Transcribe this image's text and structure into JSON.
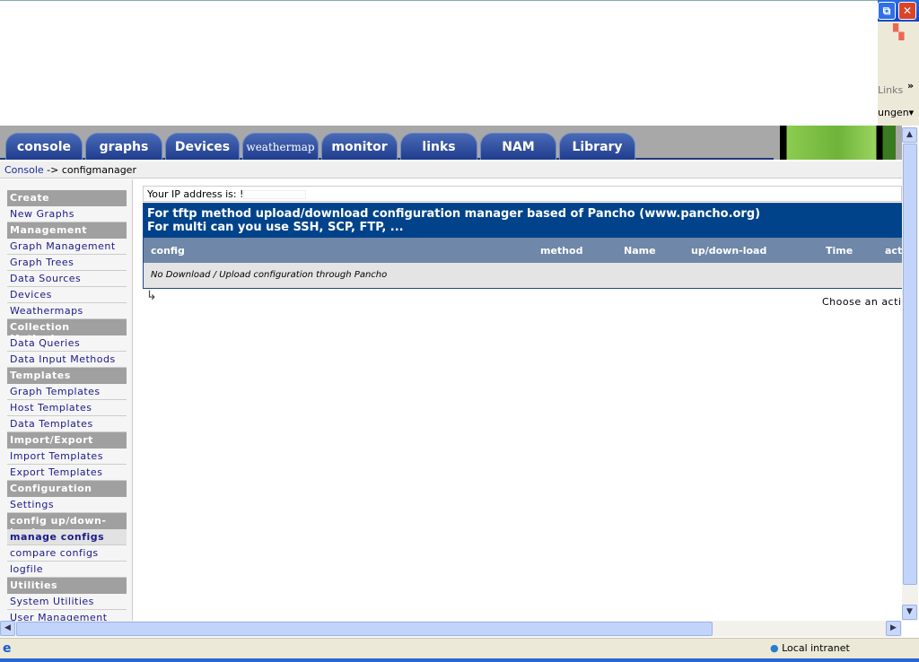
{
  "browser": {
    "links_label": "Links",
    "links_chevron": "»",
    "toolbar_partial": "ungen▾",
    "restore_icon": "⧉",
    "close_icon": "✕",
    "status_zone": "Local intranet"
  },
  "tabs": [
    {
      "label": "console"
    },
    {
      "label": "graphs"
    },
    {
      "label": "Devices"
    },
    {
      "label": "weathermap"
    },
    {
      "label": "monitor"
    },
    {
      "label": "links"
    },
    {
      "label": "NAM"
    },
    {
      "label": "Library"
    }
  ],
  "breadcrumb": {
    "root": "Console",
    "separator": " -> ",
    "current": "configmanager"
  },
  "sidebar": [
    {
      "type": "header",
      "label": "Create"
    },
    {
      "type": "item",
      "label": "New Graphs"
    },
    {
      "type": "header",
      "label": "Management"
    },
    {
      "type": "item",
      "label": "Graph Management"
    },
    {
      "type": "item",
      "label": "Graph Trees"
    },
    {
      "type": "item",
      "label": "Data Sources"
    },
    {
      "type": "item",
      "label": "Devices"
    },
    {
      "type": "item",
      "label": "Weathermaps"
    },
    {
      "type": "header",
      "label": "Collection Methods"
    },
    {
      "type": "item",
      "label": "Data Queries"
    },
    {
      "type": "item",
      "label": "Data Input Methods"
    },
    {
      "type": "header",
      "label": "Templates"
    },
    {
      "type": "item",
      "label": "Graph Templates"
    },
    {
      "type": "item",
      "label": "Host Templates"
    },
    {
      "type": "item",
      "label": "Data Templates"
    },
    {
      "type": "header",
      "label": "Import/Export"
    },
    {
      "type": "item",
      "label": "Import Templates"
    },
    {
      "type": "item",
      "label": "Export Templates"
    },
    {
      "type": "header",
      "label": "Configuration"
    },
    {
      "type": "item",
      "label": "Settings"
    },
    {
      "type": "header",
      "label": "config up/down-load"
    },
    {
      "type": "item",
      "label": "manage configs",
      "active": true
    },
    {
      "type": "item",
      "label": "compare configs"
    },
    {
      "type": "item",
      "label": "logfile"
    },
    {
      "type": "header",
      "label": "Utilities"
    },
    {
      "type": "item",
      "label": "System Utilities"
    },
    {
      "type": "item",
      "label": "User Management"
    }
  ],
  "main": {
    "ip_label": "Your IP address is: !",
    "banner_line1": "For tftp method upload/download configuration manager based of Pancho (www.pancho.org)",
    "banner_line2": "For multi can you use SSH, SCP, FTP, ...",
    "columns": [
      "config",
      "method",
      "Name",
      "up/down-load",
      "Time",
      "acti"
    ],
    "empty_message": "No Download / Upload configuration through Pancho",
    "arrow_icon": "↳",
    "action_label": "Choose an actio"
  }
}
